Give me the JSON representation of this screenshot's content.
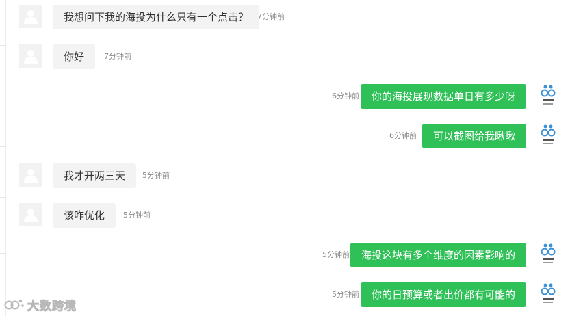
{
  "messages": [
    {
      "side": "in",
      "text": "我想问下我的海投为什么只有一个点击？",
      "time": "7分钟前"
    },
    {
      "side": "in",
      "text": "你好",
      "time": "7分钟前"
    },
    {
      "side": "out",
      "text": "你的海投展现数据单日有多少呀",
      "time": "6分钟前"
    },
    {
      "side": "out",
      "text": "可以截图给我瞅瞅",
      "time": "6分钟前"
    },
    {
      "side": "in",
      "text": "我才开两三天",
      "time": "5分钟前"
    },
    {
      "side": "in",
      "text": "该咋优化",
      "time": "5分钟前"
    },
    {
      "side": "out",
      "text": "海投这块有多个维度的因素影响的",
      "time": "5分钟前"
    },
    {
      "side": "out",
      "text": "你的日预算或者出价都有可能的",
      "time": "5分钟前"
    }
  ],
  "watermark": {
    "text": "大数跨境"
  },
  "colors": {
    "outgoing_bubble": "#2fc057",
    "incoming_bubble": "#f3f3f3",
    "agent_logo": "#3b8fd4"
  }
}
